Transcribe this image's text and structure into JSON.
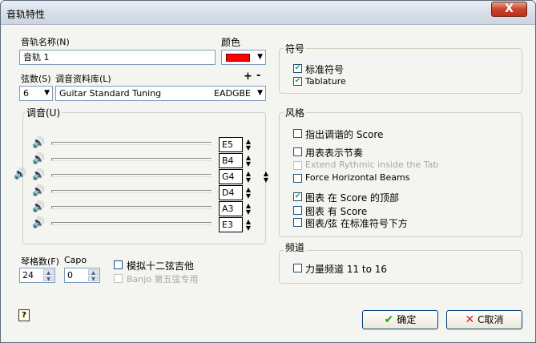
{
  "window": {
    "title": "音轨特性",
    "close_label": "X"
  },
  "track": {
    "name_label": "音轨名称(N)",
    "name_value": "音轨 1",
    "color_label": "颜色",
    "color_value": "#ff0000",
    "strings_label": "弦数(S)",
    "strings_value": "6",
    "tuning_lib_label": "调音资料库(L)",
    "tuning_name": "Guitar Standard Tuning",
    "tuning_notes": "EADGBE",
    "add_label": "+",
    "remove_label": "-"
  },
  "tuning": {
    "group_title": "调音(U)",
    "strings": [
      {
        "note": "E5"
      },
      {
        "note": "B4"
      },
      {
        "note": "G4"
      },
      {
        "note": "D4"
      },
      {
        "note": "A3"
      },
      {
        "note": "E3"
      }
    ]
  },
  "frets": {
    "frets_label": "琴格数(F)",
    "frets_value": "24",
    "capo_label": "Capo",
    "capo_value": "0",
    "simulate_12_label": "模拟十二弦吉他",
    "simulate_12_checked": false,
    "banjo_label": "Banjo 第五弦专用",
    "banjo_checked": false
  },
  "notation": {
    "group_title": "符号",
    "standard_label": "标准符号",
    "standard_checked": true,
    "tablature_label": "Tablature",
    "tablature_checked": true
  },
  "style": {
    "group_title": "风格",
    "items": [
      {
        "label": "指出调谐的 Score",
        "checked": false,
        "disabled": false
      },
      {
        "label": "用表表示节奏",
        "checked": false,
        "disabled": false
      },
      {
        "label": "Extend Rythmic inside the Tab",
        "checked": false,
        "disabled": true
      },
      {
        "label": "Force Horizontal Beams",
        "checked": false,
        "disabled": false
      },
      {
        "label": "图表 在 Score 的顶部",
        "checked": true,
        "disabled": false
      },
      {
        "label": "图表 有 Score",
        "checked": false,
        "disabled": false
      },
      {
        "label": "图表/弦 在标准符号下方",
        "checked": false,
        "disabled": false
      }
    ]
  },
  "channel": {
    "group_title": "频道",
    "heavy_label": "力量频道 11 to 16",
    "heavy_checked": false
  },
  "buttons": {
    "ok_label": "确定",
    "cancel_label": "C取消"
  },
  "colors": {
    "accent_check": "#21a121",
    "cancel_x": "#d0202a"
  }
}
